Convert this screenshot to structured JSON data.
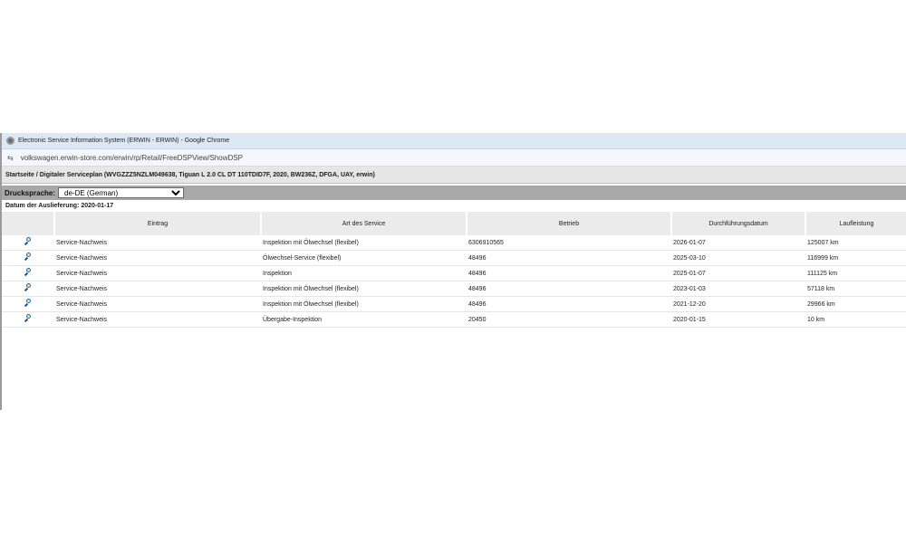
{
  "window": {
    "title": "Electronic Service Information System (ERWIN - ERWIN) - Google Chrome",
    "url": "volkswagen.erwin-store.com/erwin/rp/Retail/FreeDSPView/ShowDSP",
    "breadcrumb": "Startseite / Digitaler Serviceplan (WVGZZZ5NZLM049638, Tiguan L 2.0 CL DT 110TDID7F, 2020, BW236Z, DFGA, UAY, erwin)"
  },
  "language": {
    "label": "Drucksprache:",
    "selected": "de-DE (German)"
  },
  "delivery_date": "Datum der Auslieferung: 2020-01-17",
  "table": {
    "headers": [
      "",
      "Eintrag",
      "Art des Service",
      "Betrieb",
      "Durchführungsdatum",
      "Laufleistung"
    ],
    "rows": [
      {
        "entry": "Service-Nachweis",
        "service": "Inspektion mit Ölwechsel (flexibel)",
        "shop": "6306910565",
        "date": "2026-01-07",
        "mileage": "125007 km"
      },
      {
        "entry": "Service-Nachweis",
        "service": "Ölwechsel-Service (flexibel)",
        "shop": "48496",
        "date": "2025-03-10",
        "mileage": "116999 km"
      },
      {
        "entry": "Service-Nachweis",
        "service": "Inspektion",
        "shop": "48496",
        "date": "2025-01-07",
        "mileage": "111125 km"
      },
      {
        "entry": "Service-Nachweis",
        "service": "Inspektion mit Ölwechsel (flexibel)",
        "shop": "48496",
        "date": "2023-01-03",
        "mileage": "57118 km"
      },
      {
        "entry": "Service-Nachweis",
        "service": "Inspektion mit Ölwechsel (flexibel)",
        "shop": "48496",
        "date": "2021-12-20",
        "mileage": "29966 km"
      },
      {
        "entry": "Service-Nachweis",
        "service": "Übergabe-Inspektion",
        "shop": "20450",
        "date": "2020-01-15",
        "mileage": "10 km"
      }
    ]
  },
  "icons": {
    "browser": "chrome-icon",
    "site_settings": "tune-icon",
    "row_action": "magnifier-icon"
  }
}
